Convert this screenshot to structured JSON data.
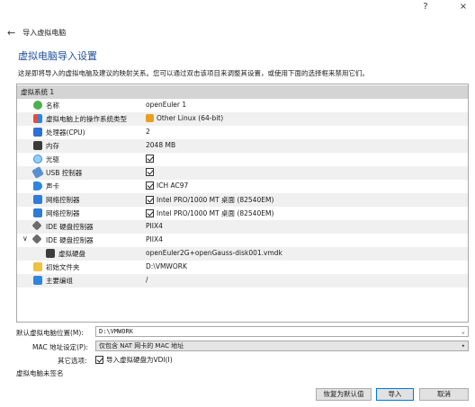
{
  "titlebar": {
    "help": "?",
    "close": "×"
  },
  "nav": {
    "back": "←",
    "title": "导入虚拟电脑"
  },
  "wizard": {
    "heading": "虚拟电脑导入设置",
    "description": "这是即将导入的虚拟电脑及建议的映射关系。您可以通过双击该项目来调整其设置，或使用下面的选择框来禁用它们。"
  },
  "tree": {
    "root": "虚拟系统 1",
    "rows": [
      {
        "label": "名称",
        "value": "openEuler 1",
        "icon": "name-icon"
      },
      {
        "label": "虚拟电脑上的操作系统类型",
        "value": "Other Linux (64-bit)",
        "icon": "os-type-icon"
      },
      {
        "label": "处理器(CPU)",
        "value": "2",
        "icon": "cpu-icon"
      },
      {
        "label": "内存",
        "value": "2048 MB",
        "icon": "memory-icon"
      },
      {
        "label": "光驱",
        "value": "",
        "check": true,
        "icon": "optical-drive-icon"
      },
      {
        "label": "USB 控制器",
        "value": "",
        "check": true,
        "icon": "usb-icon"
      },
      {
        "label": "声卡",
        "value": "ICH AC97",
        "check": true,
        "icon": "sound-card-icon"
      },
      {
        "label": "网络控制器",
        "value": "Intel PRO/1000 MT 桌面 (82540EM)",
        "check": true,
        "icon": "network-icon"
      },
      {
        "label": "网络控制器",
        "value": "Intel PRO/1000 MT 桌面 (82540EM)",
        "check": true,
        "icon": "network-icon"
      },
      {
        "label": "IDE 硬盘控制器",
        "value": "PIIX4",
        "icon": "ide-controller-icon"
      },
      {
        "label": "IDE 硬盘控制器",
        "value": "PIIX4",
        "icon": "ide-controller-icon",
        "expander": "∨"
      },
      {
        "label": "虚拟硬盘",
        "value": "openEuler2G+openGauss-disk001.vmdk",
        "icon": "virtual-disk-icon",
        "indent": true
      },
      {
        "label": "初始文件夹",
        "value": "D:\\VMWORK",
        "icon": "folder-icon"
      },
      {
        "label": "主要编组",
        "value": "/",
        "icon": "group-icon"
      }
    ]
  },
  "settings": {
    "folder_label": "默认虚拟电脑位置(M):",
    "folder_value": "D:\\VMWORK",
    "mac_label": "MAC 地址设定(P):",
    "mac_value": "仅包含 NAT 网卡的 MAC 地址",
    "other_label": "其它选项:",
    "other_option": "导入虚拟硬盘为VDI(I)",
    "unsigned": "虚拟电脑未签名"
  },
  "buttons": {
    "restore": "恢复为默认值",
    "import": "导入",
    "cancel": "取消"
  }
}
